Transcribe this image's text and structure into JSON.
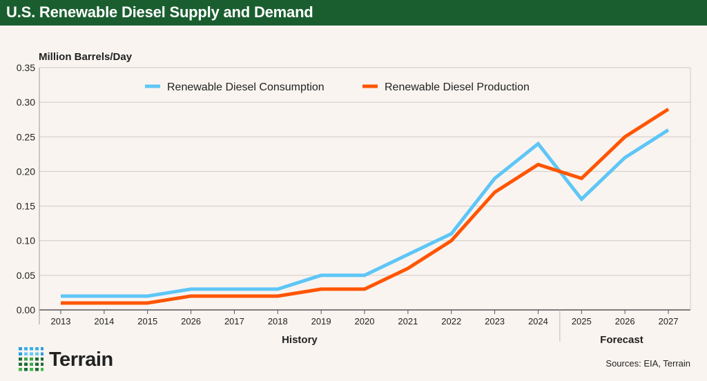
{
  "header": {
    "title": "U.S. Renewable Diesel Supply and Demand"
  },
  "chart_data": {
    "type": "line",
    "title": "U.S. Renewable Diesel Supply and Demand",
    "ylabel": "Million Barrels/Day",
    "xlabel": "",
    "categories": [
      "2013",
      "2014",
      "2015",
      "2026",
      "2017",
      "2018",
      "2019",
      "2020",
      "2021",
      "2022",
      "2023",
      "2024",
      "2025",
      "2026",
      "2027"
    ],
    "ylim": [
      0,
      0.35
    ],
    "yticks": [
      "0.00",
      "0.05",
      "0.10",
      "0.15",
      "0.20",
      "0.25",
      "0.30",
      "0.35"
    ],
    "grid": true,
    "legend": "top-center",
    "series": [
      {
        "name": "Renewable Diesel Consumption",
        "color": "#5ec6f6",
        "values": [
          0.02,
          0.02,
          0.02,
          0.03,
          0.03,
          0.03,
          0.05,
          0.05,
          0.08,
          0.11,
          0.19,
          0.24,
          0.16,
          0.22,
          0.26
        ]
      },
      {
        "name": "Renewable Diesel Production",
        "color": "#ff5500",
        "values": [
          0.01,
          0.01,
          0.01,
          0.02,
          0.02,
          0.02,
          0.03,
          0.03,
          0.06,
          0.1,
          0.17,
          0.21,
          0.19,
          0.25,
          0.29
        ]
      }
    ],
    "groups": [
      {
        "label": "History",
        "from": "2013",
        "to": "2024"
      },
      {
        "label": "Forecast",
        "from": "2025",
        "to": "2027"
      }
    ]
  },
  "footer": {
    "logo": "Terrain",
    "sources": "Sources: EIA, Terrain"
  },
  "colors": {
    "header": "#1a5e30",
    "background": "#f9f4f0"
  }
}
